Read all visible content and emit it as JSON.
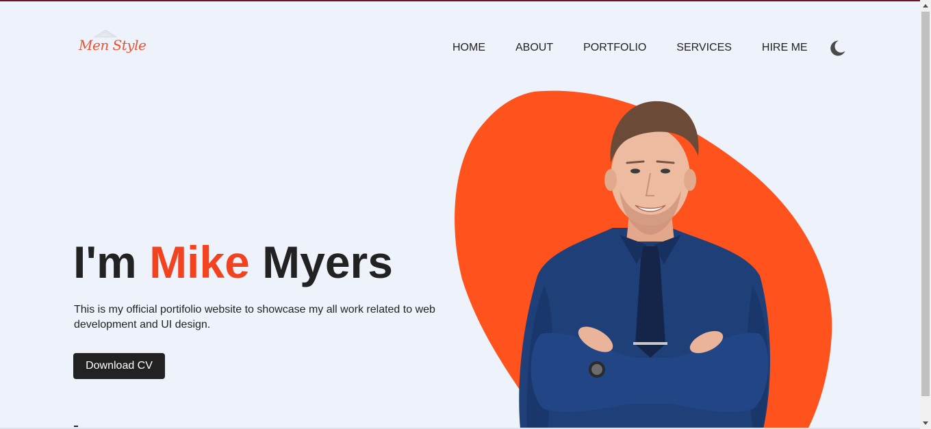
{
  "logo": {
    "text": "Men Style"
  },
  "nav": {
    "items": [
      {
        "label": "HOME"
      },
      {
        "label": "ABOUT"
      },
      {
        "label": "PORTFOLIO"
      },
      {
        "label": "SERVICES"
      },
      {
        "label": "HIRE ME"
      }
    ],
    "theme_toggle_icon": "moon-icon"
  },
  "hero": {
    "title_prefix": "I'm",
    "title_accent": "Mike",
    "title_suffix": "Myers",
    "description": "This is my official portifolio website to showcase my all work related to web development and UI design.",
    "cta_label": "Download CV",
    "image_icon": "person-portrait-illustration"
  },
  "colors": {
    "accent": "#f3421f",
    "blob": "#ff521d",
    "background": "#eef2fb",
    "text": "#222222",
    "button_bg": "#222222"
  }
}
